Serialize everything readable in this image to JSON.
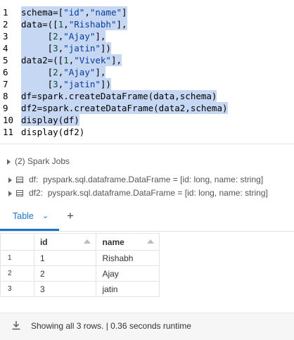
{
  "code": {
    "lines": [
      {
        "n": "1",
        "text": "schema=[\"id\",\"name\"]",
        "selected": true
      },
      {
        "n": "2",
        "text": "data=([1,\"Rishabh\"],",
        "selected": true
      },
      {
        "n": "3",
        "text": "     [2,\"Ajay\"],",
        "selected": true
      },
      {
        "n": "4",
        "text": "     [3,\"jatin\"])",
        "selected": true
      },
      {
        "n": "5",
        "text": "data2=([1,\"Vivek\"],",
        "selected": true
      },
      {
        "n": "6",
        "text": "     [2,\"Ajay\"],",
        "selected": true
      },
      {
        "n": "7",
        "text": "     [3,\"jatin\"])",
        "selected": true
      },
      {
        "n": "8",
        "text": "df=spark.createDataFrame(data,schema)",
        "selected": true
      },
      {
        "n": "9",
        "text": "df2=spark.createDataFrame(data2,schema)",
        "selected": true
      },
      {
        "n": "10",
        "text": "display(df)",
        "selected": true
      },
      {
        "n": "11",
        "text": "display(df2)",
        "selected": false
      }
    ]
  },
  "jobs": {
    "label": "(2) Spark Jobs",
    "results": [
      {
        "var": "df:",
        "desc": "pyspark.sql.dataframe.DataFrame = [id: long, name: string]"
      },
      {
        "var": "df2:",
        "desc": "pyspark.sql.dataframe.DataFrame = [id: long, name: string]"
      }
    ]
  },
  "tabs": {
    "active": "Table",
    "chevron": "⌄",
    "add": "+"
  },
  "table": {
    "headers": [
      "id",
      "name"
    ],
    "rows": [
      {
        "index": "1",
        "id": "1",
        "name": "Rishabh"
      },
      {
        "index": "2",
        "id": "2",
        "name": "Ajay"
      },
      {
        "index": "3",
        "id": "3",
        "name": "jatin"
      }
    ]
  },
  "footer": {
    "icon": "download-icon",
    "status": "Showing all 3 rows.  |  0.36 seconds runtime"
  },
  "colors": {
    "selection": "#c5d7f3",
    "accent": "#1a73c7"
  }
}
